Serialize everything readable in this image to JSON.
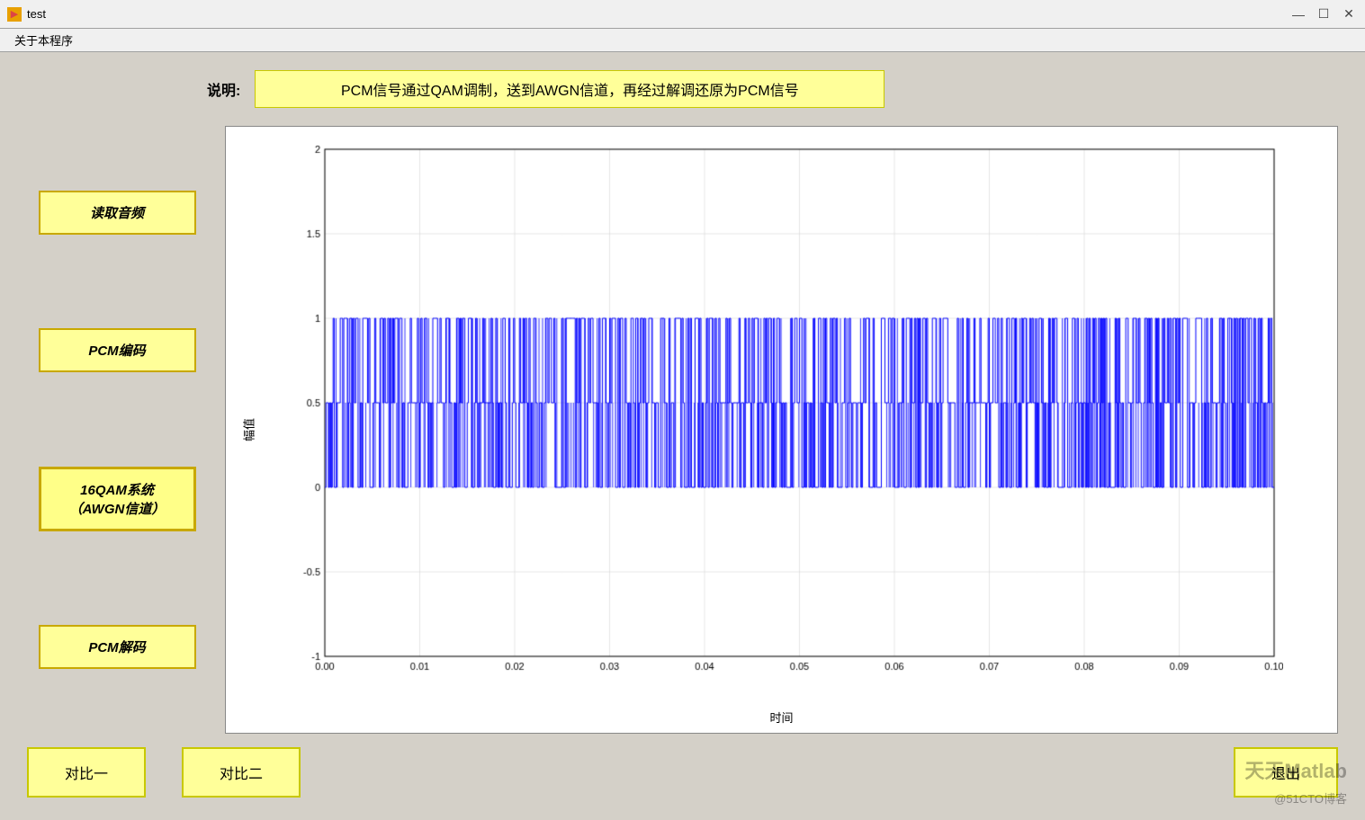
{
  "titleBar": {
    "icon": "▶",
    "title": "test",
    "minimizeLabel": "—",
    "maximizeLabel": "☐",
    "closeLabel": "✕"
  },
  "menuBar": {
    "items": [
      {
        "label": "关于本程序"
      }
    ]
  },
  "description": {
    "label": "说明:",
    "text": "PCM信号通过QAM调制，送到AWGN信道，再经过解调还原为PCM信号"
  },
  "buttons": {
    "readAudio": "读取音频",
    "pcmEncode": "PCM编码",
    "qam16": "16QAM系统（AWGN信道）",
    "pcmDecode": "PCM解码"
  },
  "chart": {
    "yAxisLabel": "幅值",
    "xAxisLabel": "时间",
    "yTicks": [
      "2",
      "1.5",
      "1",
      "0.5",
      "0",
      "-0.5",
      "-1"
    ],
    "xTicks": [
      "0",
      "0.01",
      "0.02",
      "0.03",
      "0.04",
      "0.05",
      "0.06",
      "0.07",
      "0.08",
      "0.09",
      "0.1"
    ]
  },
  "bottomButtons": {
    "compare1": "对比一",
    "compare2": "对比二",
    "exit": "退出"
  },
  "watermark": {
    "line1": "天天Matlab",
    "line2": "@51CTO博客"
  }
}
